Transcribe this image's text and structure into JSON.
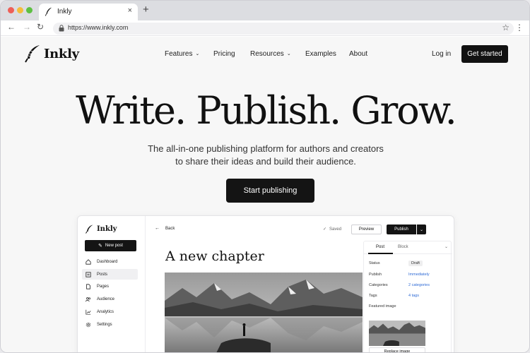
{
  "browser": {
    "tab_title": "Inkly",
    "tab_close": "×",
    "new_tab": "+",
    "url": "https://www.inkly.com",
    "icons": [
      "back-arrow-icon",
      "forward-arrow-icon",
      "reload-icon",
      "lock-icon",
      "star-icon",
      "kebab-menu-icon"
    ]
  },
  "site": {
    "logo": "Inkly",
    "nav": [
      {
        "label": "Features",
        "dropdown": true
      },
      {
        "label": "Pricing",
        "dropdown": false
      },
      {
        "label": "Resources",
        "dropdown": true
      },
      {
        "label": "Examples",
        "dropdown": false
      },
      {
        "label": "About",
        "dropdown": false
      }
    ],
    "login": "Log in",
    "cta": "Get started",
    "hero": {
      "title": "Write. Publish. Grow.",
      "subtitle_line1": "The all-in-one publishing platform for authors and creators",
      "subtitle_line2": "to share their ideas and build their audience.",
      "cta": "Start publishing"
    }
  },
  "app": {
    "logo": "Inkly",
    "new_post": "New post",
    "sidebar": [
      {
        "label": "Dashboard",
        "icon": "home-icon",
        "active": false
      },
      {
        "label": "Posts",
        "icon": "posts-icon",
        "active": true
      },
      {
        "label": "Pages",
        "icon": "page-icon",
        "active": false
      },
      {
        "label": "Audience",
        "icon": "users-icon",
        "active": false
      },
      {
        "label": "Analytics",
        "icon": "chart-icon",
        "active": false
      },
      {
        "label": "Settings",
        "icon": "gear-icon",
        "active": false
      }
    ],
    "back": "Back",
    "saved": "Saved",
    "preview": "Preview",
    "publish": "Publish",
    "doc_title": "A new chapter",
    "panel": {
      "tabs": [
        "Post",
        "Block"
      ],
      "rows": [
        {
          "label": "Status",
          "value": "Draft"
        },
        {
          "label": "Publish",
          "value": "Immediately"
        },
        {
          "label": "Categories",
          "value": "2 categories"
        },
        {
          "label": "Tags",
          "value": "4 tags"
        }
      ],
      "featured_label": "Featured image",
      "replace": "Replace image"
    }
  },
  "colors": {
    "accent_dark": "#121212",
    "link_blue": "#2f6bd6",
    "page_bg": "#f7f7f7"
  }
}
